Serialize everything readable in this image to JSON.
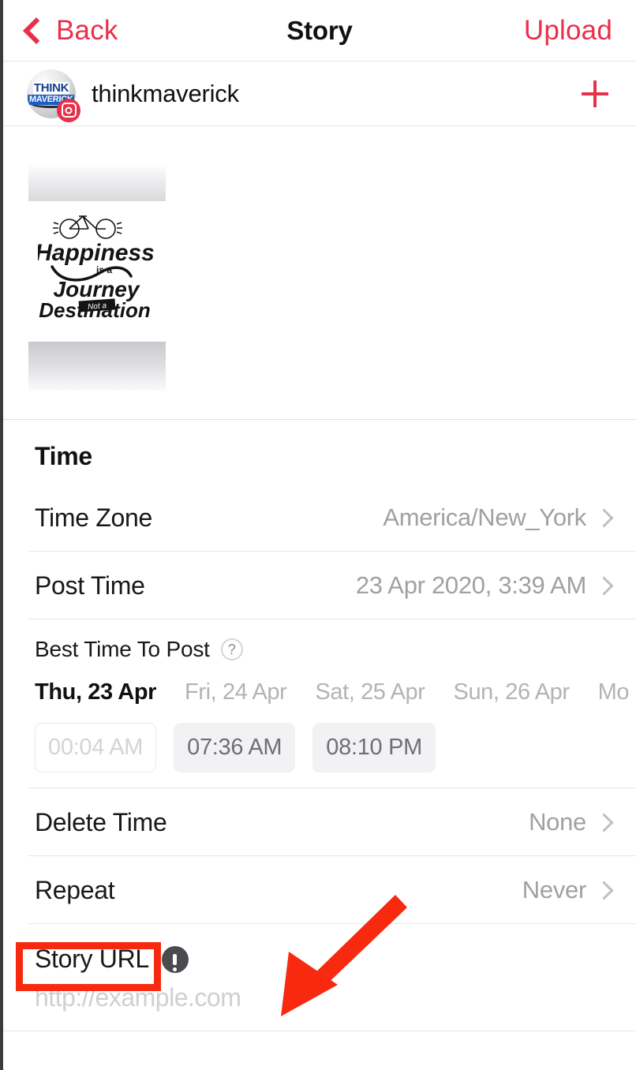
{
  "navbar": {
    "back_label": "Back",
    "title": "Story",
    "upload_label": "Upload",
    "accent_color": "#e8304a"
  },
  "account": {
    "username": "thinkmaverick",
    "avatar_text_line1": "THINK",
    "avatar_text_line2": "MAVERICK",
    "platform_badge": "instagram-icon",
    "add_label": "+"
  },
  "media": {
    "artwork_line1": "Happiness",
    "artwork_line2": "is a",
    "artwork_line3": "Journey",
    "artwork_line4": "Not a",
    "artwork_line5": "Destination",
    "artwork_icon": "bicycle-icon"
  },
  "time_section": {
    "title": "Time",
    "rows": [
      {
        "label": "Time Zone",
        "value": "America/New_York"
      },
      {
        "label": "Post Time",
        "value": "23 Apr 2020, 3:39 AM"
      }
    ]
  },
  "best_time": {
    "title": "Best Time To Post",
    "help_icon": "question-mark-icon",
    "days": [
      {
        "label": "Thu, 23 Apr",
        "active": true
      },
      {
        "label": "Fri, 24 Apr",
        "active": false
      },
      {
        "label": "Sat, 25 Apr",
        "active": false
      },
      {
        "label": "Sun, 26 Apr",
        "active": false
      },
      {
        "label": "Mo",
        "active": false
      }
    ],
    "slots": [
      {
        "label": "00:04 AM",
        "state": "disabled"
      },
      {
        "label": "07:36 AM",
        "state": "normal"
      },
      {
        "label": "08:10 PM",
        "state": "normal"
      }
    ]
  },
  "other_rows": [
    {
      "label": "Delete Time",
      "value": "None"
    },
    {
      "label": "Repeat",
      "value": "Never"
    }
  ],
  "story_url": {
    "label": "Story URL",
    "alert_icon": "exclamation-circle-icon",
    "placeholder": "http://example.com",
    "value": ""
  },
  "annotations": {
    "highlight_color": "#f72a10",
    "highlight_target": "Story URL",
    "arrow_color": "#f72a10",
    "arrow_points_to": "story-url-input"
  }
}
